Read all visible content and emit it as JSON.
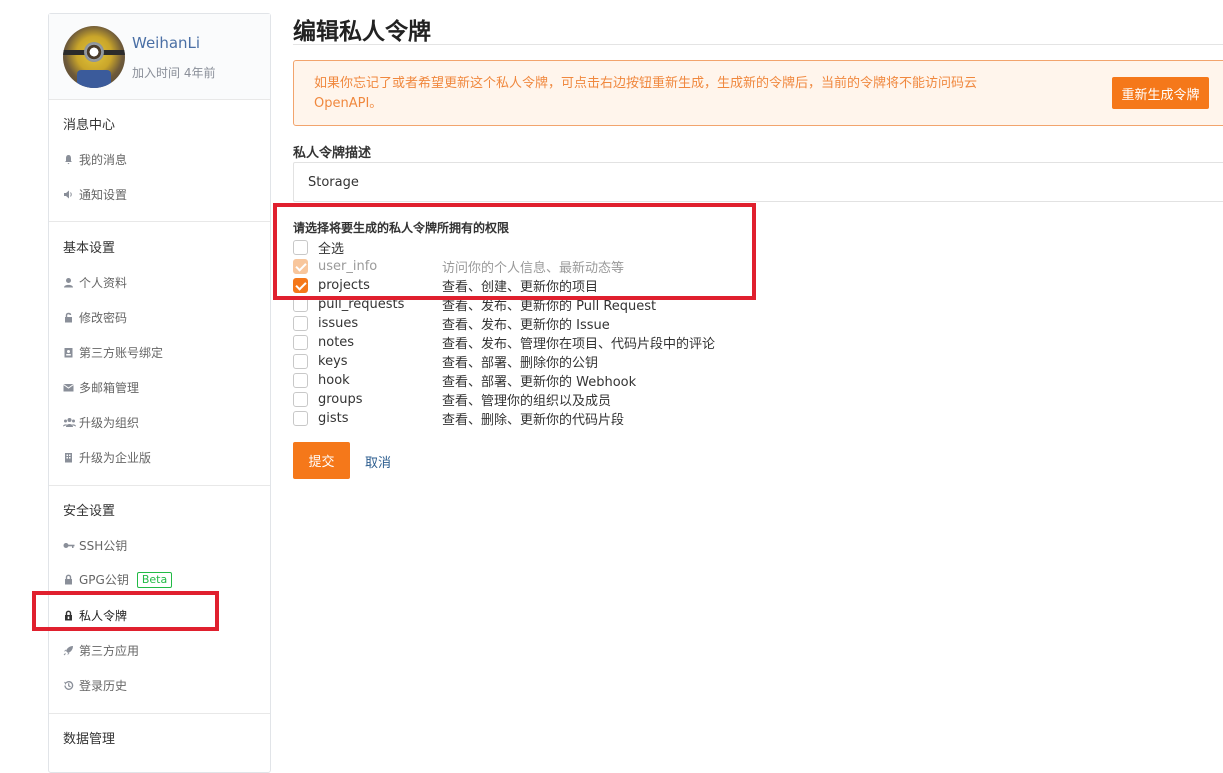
{
  "profile": {
    "name": "WeihanLi",
    "joined": "加入时间 4年前"
  },
  "sidebar": {
    "sections": [
      {
        "title": "消息中心",
        "items": [
          {
            "label": "我的消息",
            "icon": "bell-icon"
          },
          {
            "label": "通知设置",
            "icon": "speaker-icon"
          }
        ]
      },
      {
        "title": "基本设置",
        "items": [
          {
            "label": "个人资料",
            "icon": "user-icon"
          },
          {
            "label": "修改密码",
            "icon": "unlock-icon"
          },
          {
            "label": "第三方账号绑定",
            "icon": "id-card-icon"
          },
          {
            "label": "多邮箱管理",
            "icon": "envelope-icon"
          },
          {
            "label": "升级为组织",
            "icon": "users-icon"
          },
          {
            "label": "升级为企业版",
            "icon": "enterprise-icon"
          }
        ]
      },
      {
        "title": "安全设置",
        "items": [
          {
            "label": "SSH公钥",
            "icon": "key-icon"
          },
          {
            "label": "GPG公钥",
            "icon": "lock-icon",
            "badge": "Beta"
          },
          {
            "label": "私人令牌",
            "icon": "token-icon",
            "active": true
          },
          {
            "label": "第三方应用",
            "icon": "rocket-icon"
          },
          {
            "label": "登录历史",
            "icon": "history-icon"
          }
        ]
      },
      {
        "title": "数据管理",
        "items": []
      }
    ]
  },
  "main": {
    "title": "编辑私人令牌",
    "alert": {
      "text": "如果你忘记了或者希望更新这个私人令牌，可点击右边按钮重新生成，生成新的令牌后，当前的令牌将不能访问码云 OpenAPI。",
      "button": "重新生成令牌"
    },
    "description": {
      "label": "私人令牌描述",
      "value": "Storage"
    },
    "permissions": {
      "label": "请选择将要生成的私人令牌所拥有的权限",
      "select_all": "全选",
      "items": [
        {
          "name": "user_info",
          "desc": "访问你的个人信息、最新动态等",
          "checked": true,
          "disabled": true
        },
        {
          "name": "projects",
          "desc": "查看、创建、更新你的项目",
          "checked": true,
          "disabled": false
        },
        {
          "name": "pull_requests",
          "desc": "查看、发布、更新你的 Pull Request",
          "checked": false,
          "disabled": false
        },
        {
          "name": "issues",
          "desc": "查看、发布、更新你的 Issue",
          "checked": false,
          "disabled": false
        },
        {
          "name": "notes",
          "desc": "查看、发布、管理你在项目、代码片段中的评论",
          "checked": false,
          "disabled": false
        },
        {
          "name": "keys",
          "desc": "查看、部署、删除你的公钥",
          "checked": false,
          "disabled": false
        },
        {
          "name": "hook",
          "desc": "查看、部署、更新你的 Webhook",
          "checked": false,
          "disabled": false
        },
        {
          "name": "groups",
          "desc": "查看、管理你的组织以及成员",
          "checked": false,
          "disabled": false
        },
        {
          "name": "gists",
          "desc": "查看、删除、更新你的代码片段",
          "checked": false,
          "disabled": false
        }
      ]
    },
    "actions": {
      "submit": "提交",
      "cancel": "取消"
    }
  },
  "colors": {
    "accent": "#f5781a",
    "highlight": "#e0202e",
    "link": "#2c5d8f",
    "badge": "#21ba45"
  }
}
